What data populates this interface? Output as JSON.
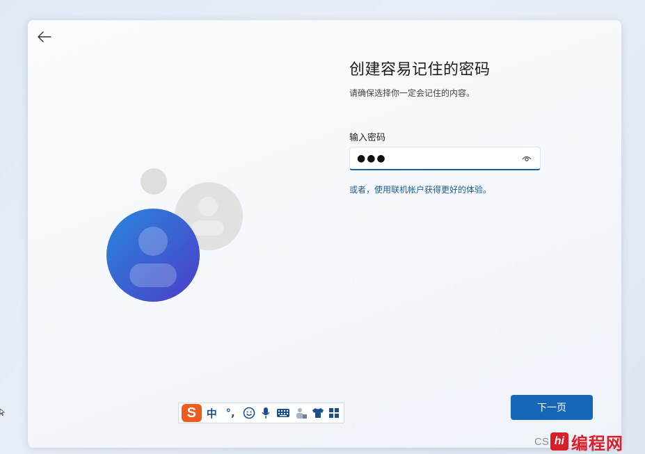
{
  "page": {
    "title": "创建容易记住的密码",
    "subtitle": "请确保选择你一定会记住的内容。",
    "password_label": "输入密码",
    "password_value": "●●●",
    "online_account_link": "或者，使用联机帐户获得更好的体验。",
    "next_button": "下一页"
  },
  "icons": {
    "back": "arrow-left-icon",
    "reveal": "eye-icon",
    "avatar_main": "user-avatar-icon",
    "avatar_secondary": "user-avatar-icon"
  },
  "ime_toolbar": {
    "logo": "S",
    "mode": "中",
    "punct": "°,",
    "items": [
      "emoji-icon",
      "microphone-icon",
      "keyboard-icon",
      "user-tools-icon",
      "skin-shirt-icon",
      "apps-grid-icon"
    ]
  },
  "watermark": {
    "cs_text": "CS",
    "logo": "hi",
    "brand": "编程网"
  },
  "colors": {
    "accent": "#1767b8",
    "link": "#1f5a8e",
    "avatar_gradient_top": "#2b7fd6",
    "avatar_gradient_bottom": "#4a3fc9",
    "ime_logo": "#ef5a1e",
    "watermark_red": "#d81f2a"
  }
}
